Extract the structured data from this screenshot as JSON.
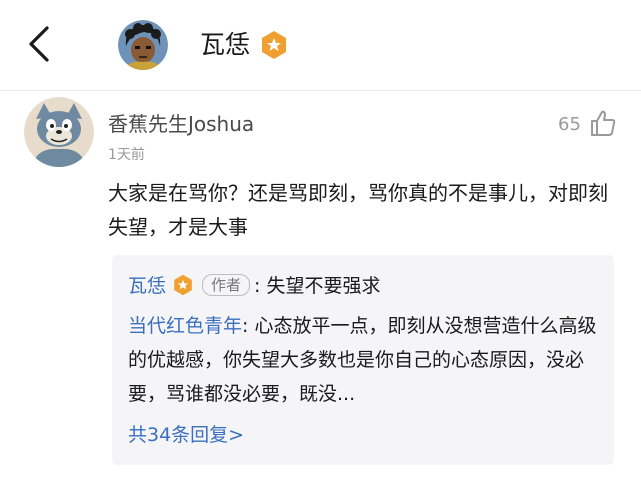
{
  "header": {
    "title": "瓦恁",
    "back_icon": "chevron-left-icon",
    "badge_icon": "verified-badge-icon",
    "badge_color": "#F0A030"
  },
  "comment": {
    "username": "香蕉先生Joshua",
    "time": "1天前",
    "like_count": "65",
    "like_icon": "thumbs-up-icon",
    "body": "大家是在骂你？还是骂即刻，骂你真的不是事儿，对即刻失望，才是大事"
  },
  "replies": {
    "first": {
      "name": "瓦恁",
      "author_tag": "作者",
      "text": ": 失望不要强求"
    },
    "second": {
      "name": "当代红色青年",
      "text": ": 心态放平一点，即刻从没想营造什么高级的优越感，你失望大多数也是你自己的心态原因，没必要，骂谁都没必要，既没..."
    },
    "more_label": "共34条回复>"
  },
  "colors": {
    "link_blue": "#3A6FBF",
    "reply_bg": "#F5F5F7",
    "muted": "#9A9A9A"
  }
}
